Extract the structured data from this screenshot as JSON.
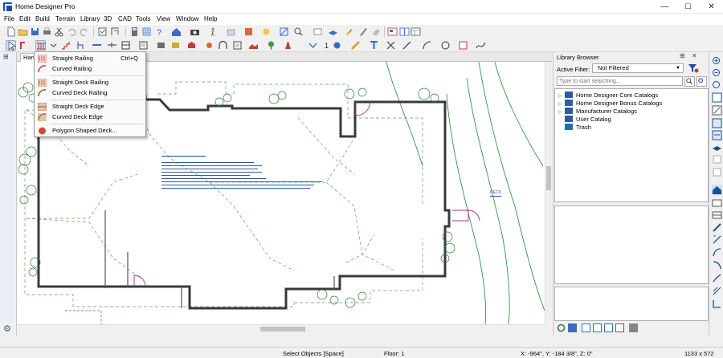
{
  "window": {
    "title": "Home Designer Pro",
    "minimize": "—",
    "maximize": "☐",
    "close": "✕"
  },
  "menu": [
    "File",
    "Edit",
    "Build",
    "Terrain",
    "Library",
    "3D",
    "CAD",
    "Tools",
    "View",
    "Window",
    "Help"
  ],
  "view_tab": {
    "label": "Harris"
  },
  "dropdown": {
    "items": [
      {
        "label": "Straight Railing",
        "shortcut": "Ctrl+Q",
        "icon": "straight-railing-icon"
      },
      {
        "label": "Curved Railing",
        "shortcut": "",
        "icon": "curved-railing-icon"
      },
      {
        "label": "Straight Deck Railing",
        "shortcut": "",
        "icon": "straight-deck-railing-icon"
      },
      {
        "label": "Curved Deck Railing",
        "shortcut": "",
        "icon": "curved-deck-railing-icon"
      },
      {
        "label": "Straight Deck Edge",
        "shortcut": "",
        "icon": "straight-deck-edge-icon"
      },
      {
        "label": "Curved Deck Edge",
        "shortcut": "",
        "icon": "curved-deck-edge-icon"
      },
      {
        "label": "Polygon Shaped Deck...",
        "shortcut": "",
        "icon": "polygon-deck-icon"
      }
    ]
  },
  "library": {
    "title": "Library Browser",
    "filter_label": "Active Filter:",
    "filter_value": "Not Filtered",
    "search_placeholder": "Type to start searching...",
    "tree": [
      {
        "label": "Home Designer Core Catalogs",
        "expandable": true
      },
      {
        "label": "Home Designer Bonus Catalogs",
        "expandable": true
      },
      {
        "label": "Manufacturer Catalogs",
        "expandable": true
      },
      {
        "label": "User Catalog",
        "expandable": false
      },
      {
        "label": "Trash",
        "expandable": false
      }
    ]
  },
  "plan": {
    "note_label": "DECK"
  },
  "status": {
    "mode": "Select Objects [Space]",
    "floor": "Floor: 1",
    "coords": "X: -964\", Y: -184 3/8\", Z: 0\"",
    "size": "1133 x 572"
  },
  "colors": {
    "accent": "#1a4f9c",
    "wall": "#3a3a3a",
    "terrain": "#1f8a2e",
    "dash": "#5ea35a",
    "door": "#a0309c"
  }
}
